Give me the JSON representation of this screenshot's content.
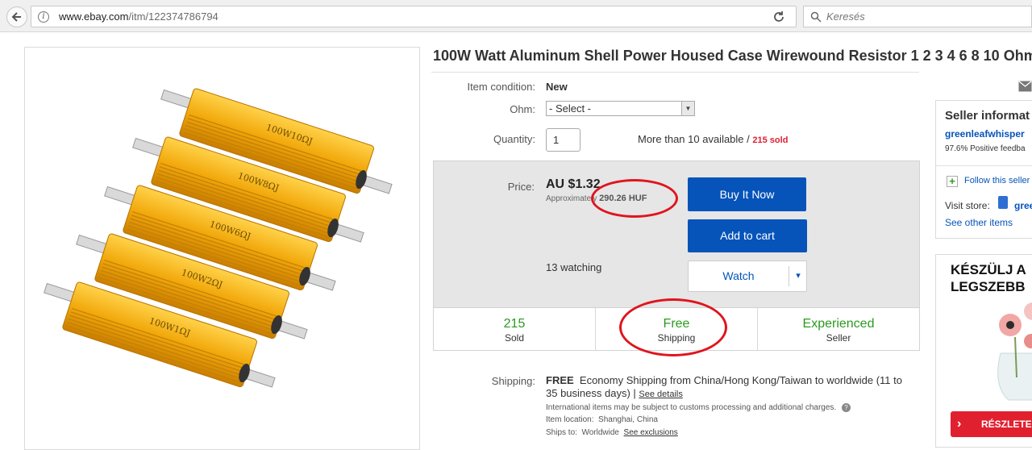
{
  "browser": {
    "url_prefix": "www.ebay.com",
    "url_path": "/itm/122374786794",
    "search_placeholder": "Keresés"
  },
  "item": {
    "title": "100W Watt Aluminum Shell Power Housed Case Wirewound Resistor 1 2 3 4 6 8 10 Ohm",
    "condition_label": "Item condition:",
    "condition_value": "New",
    "ohm_label": "Ohm:",
    "ohm_selected": "- Select -",
    "quantity_label": "Quantity:",
    "quantity_value": "1",
    "availability": "More than 10 available /",
    "sold_count": "215 sold",
    "image_labels": [
      "100W10ΩJ",
      "100W8ΩJ",
      "100W6ΩJ",
      "100W2ΩJ",
      "100W1ΩJ"
    ]
  },
  "price": {
    "label": "Price:",
    "value": "AU $1.32",
    "approx_prefix": "Approximately",
    "approx_value": "290.26 HUF",
    "buy_now": "Buy It Now",
    "add_to_cart": "Add to cart",
    "watch": "Watch",
    "watch_arrow": "▾",
    "watching": "13 watching"
  },
  "stats": [
    {
      "big": "215",
      "small": "Sold"
    },
    {
      "big": "Free",
      "small": "Shipping"
    },
    {
      "big": "Experienced",
      "small": "Seller"
    }
  ],
  "shipping": {
    "label": "Shipping:",
    "free": "FREE",
    "text": "Economy Shipping from China/Hong Kong/Taiwan to worldwide (11 to 35 business days) |",
    "see_details": "See details",
    "customs": "International items may be subject to customs processing and additional charges.",
    "location_label": "Item location:",
    "location_value": "Shanghai, China",
    "ships_to_label": "Ships to:",
    "ships_to_value": "Worldwide",
    "see_exclusions": "See exclusions"
  },
  "seller": {
    "heading": "Seller informat",
    "name": "greenleafwhisper",
    "feedback": "97.6% Positive feedba",
    "follow": "Follow this seller",
    "visit_store": "Visit store:",
    "store_link": "gree",
    "other_items": "See other items"
  },
  "ad": {
    "line1": "KÉSZÜLJ A",
    "line2": "LEGSZEBB",
    "button": "RÉSZLETE"
  },
  "colors": {
    "ebay_blue": "#0654ba",
    "stat_green": "#2a9a1e",
    "sold_red": "#dd1e31",
    "annotation_red": "#e0141e"
  }
}
